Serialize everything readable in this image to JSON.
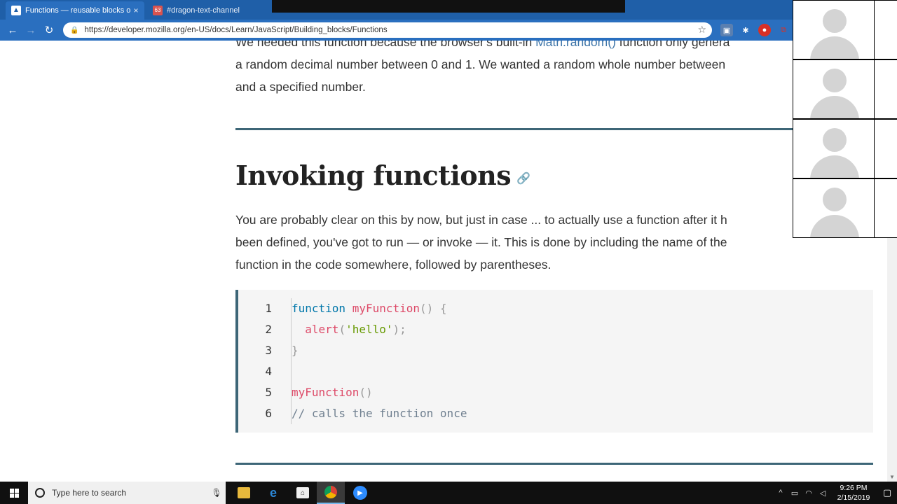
{
  "browser": {
    "tabs": [
      {
        "title": "Functions — reusable blocks of c",
        "active": true,
        "close": "×"
      },
      {
        "title": "#dragon-text-channel",
        "active": false,
        "favicon_text": "63"
      }
    ],
    "url": "https://developer.mozilla.org/en-US/docs/Learn/JavaScript/Building_blocks/Functions",
    "nav": {
      "back": "←",
      "forward": "→",
      "reload": "↻"
    },
    "accent_color": "#2a6fbf"
  },
  "page": {
    "intro": {
      "line1_before": "We needed this function because the browser's built-in ",
      "line1_link": "Math.random()",
      "line1_after": " function only genera",
      "line2": "a random decimal number between 0 and 1. We wanted a random whole number between",
      "line3": "and a specified number."
    },
    "heading": "Invoking functions",
    "body": {
      "line1": "You are probably clear on this by now, but just in case ... to actually use a function after it h",
      "line2": "been defined, you've got to run — or invoke — it. This is done by including the name of the",
      "line3": "function in the code somewhere, followed by parentheses."
    },
    "code": {
      "line_numbers": [
        "1",
        "2",
        "3",
        "4",
        "5",
        "6"
      ],
      "l1": {
        "kw": "function",
        "fn": "myFunction",
        "rest": "() {"
      },
      "l2": {
        "fn": "alert",
        "open": "(",
        "str": "'hello'",
        "close": ");"
      },
      "l3": {
        "text": "}"
      },
      "l5": {
        "fn": "myFunction",
        "rest": "()"
      },
      "l6": {
        "comment": "// calls the function once"
      }
    }
  },
  "taskbar": {
    "search_placeholder": "Type here to search",
    "time": "9:26 PM",
    "date": "2/15/2019"
  }
}
